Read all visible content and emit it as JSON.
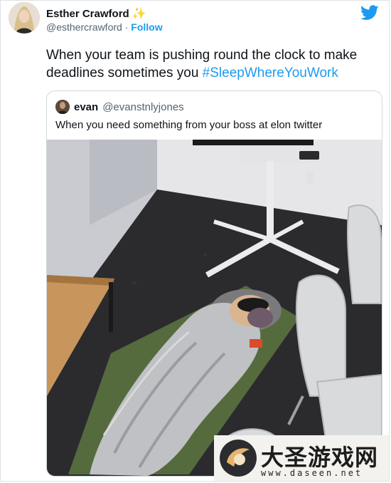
{
  "author": {
    "name": "Esther Crawford",
    "name_emoji": "sparkles-icon",
    "handle": "@esthercrawford",
    "separator": "·",
    "follow_label": "Follow"
  },
  "tweet": {
    "text": "When your team is pushing round the clock to make deadlines sometimes you ",
    "hashtag": "#SleepWhereYouWork"
  },
  "quoted": {
    "name": "evan",
    "handle": "@evanstnlyjones",
    "text": "When you need something from your boss at elon twitter"
  },
  "watermark": {
    "title": "大圣游戏网",
    "url": "www.daseen.net"
  },
  "colors": {
    "accent": "#1d9bf0",
    "text": "#0f1419",
    "muted": "#536471"
  }
}
